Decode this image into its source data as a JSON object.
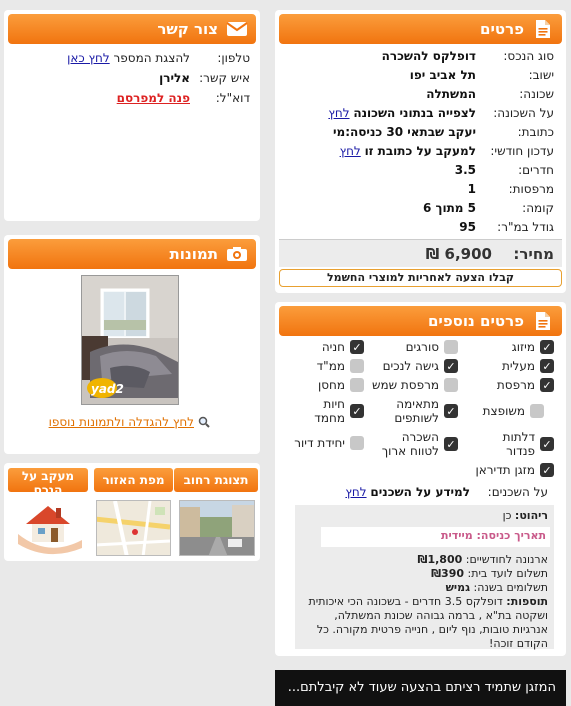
{
  "details": {
    "title": "פרטים",
    "rows": [
      {
        "label": "סוג הנכס:",
        "value": "דופלקס להשכרה"
      },
      {
        "label": "ישוב:",
        "value": "תל אביב יפו"
      },
      {
        "label": "שכונה:",
        "value": "המשתלה"
      },
      {
        "label": "על השכונה:",
        "value": "לצפייה בנתוני השכונה",
        "link": "לחץ"
      },
      {
        "label": "כתובת:",
        "value": "יעקב שבתאי 30 כניסה:מי"
      },
      {
        "label": "עדכון חודשי:",
        "value": "למעקב על כתובת זו",
        "link": "לחץ"
      },
      {
        "label": "חדרים:",
        "value": "3.5"
      },
      {
        "label": "מרפסות:",
        "value": "1"
      },
      {
        "label": "קומה:",
        "value": "5 מתוך 6"
      },
      {
        "label": "גודל במ\"ר:",
        "value": "95"
      }
    ],
    "price_label": "מחיר:",
    "price_value": "6,900 ₪",
    "offer_text": "קבלו הצעה לאחריות למוצרי החשמל"
  },
  "contact": {
    "title": "צור קשר",
    "phone_label": "טלפון:",
    "phone_text": "להצגת המספר",
    "phone_link": "לחץ כאן",
    "person_label": "איש קשר:",
    "person_value": "אלירן",
    "email_label": "דוא\"ל:",
    "email_link": "פנה למפרסם"
  },
  "photos": {
    "title": "תמונות",
    "watermark": "yad2",
    "enlarge_link": "לחץ להגדלה ולתמונות נוספו"
  },
  "extra": {
    "title": "פרטים נוספים",
    "features": [
      {
        "label": "מיזוג",
        "on": true
      },
      {
        "label": "סורגים",
        "on": false
      },
      {
        "label": "חניה",
        "on": true
      },
      {
        "label": "מעלית",
        "on": true
      },
      {
        "label": "גישה לנכים",
        "on": true
      },
      {
        "label": "ממ\"ד",
        "on": false
      },
      {
        "label": "מרפסת",
        "on": true
      },
      {
        "label": "מרפסת שמש",
        "on": false
      },
      {
        "label": "מחסן",
        "on": false
      },
      {
        "label": "משופצת",
        "on": false
      },
      {
        "label": "מתאימה לשותפים",
        "on": true
      },
      {
        "label": "חיות מחמד",
        "on": true
      },
      {
        "label": "דלתות פנדור",
        "on": true
      },
      {
        "label": "השכרה לטווח ארוך",
        "on": true
      },
      {
        "label": "יחידת דיור",
        "on": false
      },
      {
        "label": "מזגן תדיראן",
        "on": true
      }
    ],
    "neighbors_label": "על השכנים:",
    "neighbors_text": "למידע על השכנים",
    "neighbors_link": "לחץ",
    "furnished_label": "ריהוט:",
    "furnished_value": "כן",
    "entry_label": "תאריך כניסה:",
    "entry_value": "מיידית",
    "arnona_label": "ארנונה לחודשיים:",
    "arnona_value": "₪1,800",
    "vaad_label": "תשלום לועד בית:",
    "vaad_value": "₪390",
    "payments_label": "תשלומים בשנה:",
    "payments_value": "גמיש",
    "notes_label": "תוספות:",
    "notes_value": "דופלקס 3.5 חדרים - בשכונה הכי איכותית ושקטה בת\"א , ברמה גבוהה שכונת המשתלה, אנרגיות טובות, נוף ליום , חנייה פרטית מקורה. כל הקודם זוכה!"
  },
  "tabs": {
    "street_view": "תצוגת רחוב",
    "area_map": "מפת האזור",
    "follow": "מעקב על הנכס"
  },
  "banner": {
    "text": "המזגן שתמיד רציתם  בהצעה שעוד לא קיבלתם..."
  }
}
